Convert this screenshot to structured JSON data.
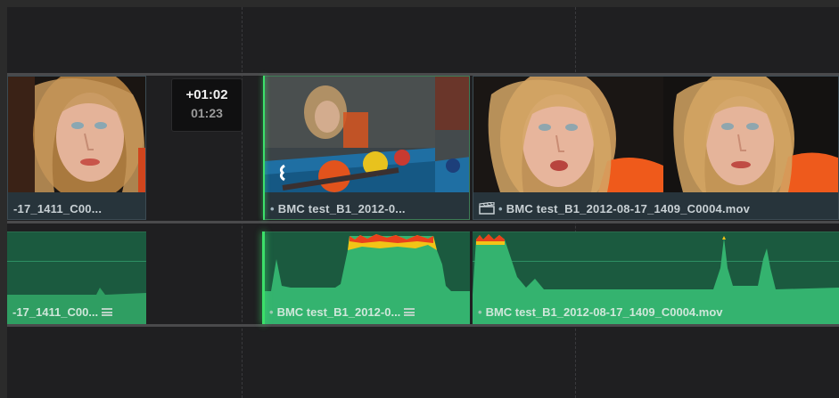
{
  "tooltip": {
    "offset": "+01:02",
    "duration": "01:23"
  },
  "video_clips": [
    {
      "label": "-17_1411_C00...",
      "has_dot": false
    },
    {
      "label": "BMC test_B1_2012-0...",
      "has_dot": true
    },
    {
      "label": "BMC test_B1_2012-08-17_1409_C0004.mov",
      "has_dot": true,
      "icon": "clapperboard-icon"
    }
  ],
  "audio_clips": [
    {
      "label": "-17_1411_C00...",
      "menu_icon": "menu-icon"
    },
    {
      "label": "BMC test_B1_2012-0...",
      "has_dot": true,
      "menu_icon": "menu-icon"
    },
    {
      "label": "BMC test_B1_2012-08-17_1409_C0004.mov",
      "has_dot": true
    }
  ],
  "colors": {
    "timeline_bg": "#1f1f21",
    "video_clip_bg": "#27343b",
    "audio_clip_bg": "#1b5a3f",
    "playhead": "#3ce06a",
    "waveform_peak_red": "#e8401c",
    "waveform_peak_yellow": "#f2c417",
    "waveform_body": "#34b36f"
  }
}
